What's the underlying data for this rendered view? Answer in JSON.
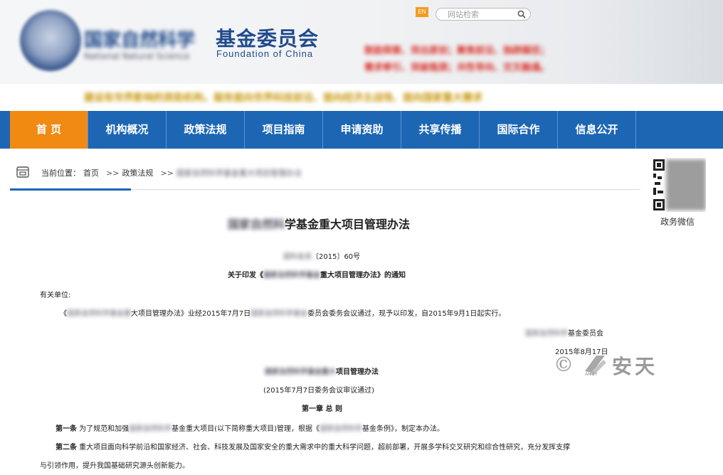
{
  "header": {
    "logo_blurred_text": "国家自然科学",
    "logo_blurred_sub": "National Natural Science",
    "logo_title": "基金委员会",
    "logo_subtitle": "Foundation of China",
    "lang_label": "EN",
    "search_placeholder": "网站检索",
    "slogan_red_line1": "鼓励探索、突出原创；聚焦前沿、独辟蹊径；",
    "slogan_red_line2": "需求牵引、突破瓶颈；共性导向、交叉融通。",
    "slogan_gold": "建设有世界影响的资助机构，服务面向世界科技前沿、面向经济主战场、面向国家重大需求"
  },
  "nav": {
    "items": [
      "首 页",
      "机构概况",
      "政策法规",
      "项目指南",
      "申请资助",
      "共享传播",
      "国际合作",
      "信息公开"
    ],
    "active_index": 0
  },
  "breadcrumb": {
    "prefix": "当前位置：",
    "home": "首页",
    "section": "政策法规",
    "current_blurred": "国家自然科学基金重大项目管理办法",
    "separator": ">>"
  },
  "qr": {
    "label": "政务微信"
  },
  "document": {
    "title_blurred": "国家自然科",
    "title": "学基金重大项目管理办法",
    "number_blurred": "国科金发",
    "number": "〔2015〕60号",
    "notice_prefix": "关于印发《",
    "notice_blurred": "国家自然科学基金",
    "notice_suffix": "重大项目管理办法》的通知",
    "salutation": "有关单位:",
    "para1_prefix": "《",
    "para1_blurred1": "国家自然科学基金重",
    "para1_mid1": "大项目管理办法》业经2015年7月7日",
    "para1_blurred2": "国家自然科学基金",
    "para1_suffix": "委员会委务会议通过，现予以印发，自2015年9月1日起实行。",
    "signature_blurred": "国家自然科学",
    "signature": "基金委员会",
    "sign_date": "2015年8月17日",
    "subtitle_blurred": "国家自然科学基金重大",
    "subtitle": "项目管理办法",
    "approval_note": "(2015年7月7日委务会议审议通过)",
    "chapter_title": "第一章 总 则",
    "article1_label": "第一条",
    "article1_prefix": " 为了规范和加强",
    "article1_blurred": "国家自然科学",
    "article1_mid": "基金重大项目(以下简称重大项目)管理，根据《",
    "article1_blurred2": "国家自然科学",
    "article1_suffix": "基金条例》，制定本办法。",
    "article2_label": "第二条",
    "article2_text": " 重大项目面向科学前沿和国家经济、社会、科技发展及国家安全的重大需求中的重大科学问题，超前部署，开展多学科交叉研究和综合性研究，充分发挥支撑",
    "article2_cont": "与引领作用，提升我国基础研究源头创新能力。"
  },
  "watermark": {
    "symbol": "©",
    "text": "安天",
    "small": "ANTIY"
  },
  "colors": {
    "nav_blue": "#1c66b4",
    "nav_active": "#f08a13",
    "title_blue": "#1f4a8c"
  }
}
